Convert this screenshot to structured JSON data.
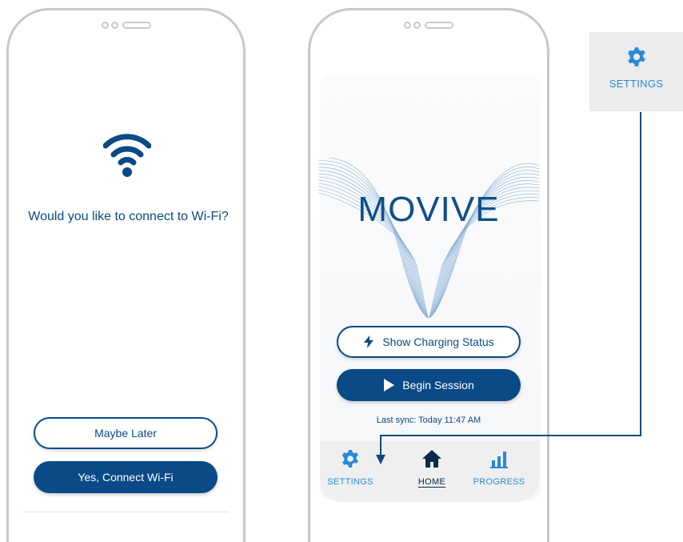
{
  "wifi_screen": {
    "question": "Would you like to connect to Wi-Fi?",
    "maybe_later_label": "Maybe Later",
    "connect_label": "Yes, Connect Wi-Fi"
  },
  "home_screen": {
    "brand": "MOVIVE",
    "charging_label": "Show Charging Status",
    "begin_label": "Begin Session",
    "last_sync": "Last sync: Today 11:47 AM",
    "tabs": [
      {
        "label": "SETTINGS",
        "icon": "gear-icon"
      },
      {
        "label": "HOME",
        "icon": "home-icon",
        "active": true
      },
      {
        "label": "PROGRESS",
        "icon": "bar-chart-icon"
      }
    ]
  },
  "callout": {
    "label": "SETTINGS",
    "icon": "gear-icon"
  },
  "colors": {
    "primary": "#0a4a86",
    "accent": "#2a8ad6",
    "tab_bg": "#efefef"
  }
}
